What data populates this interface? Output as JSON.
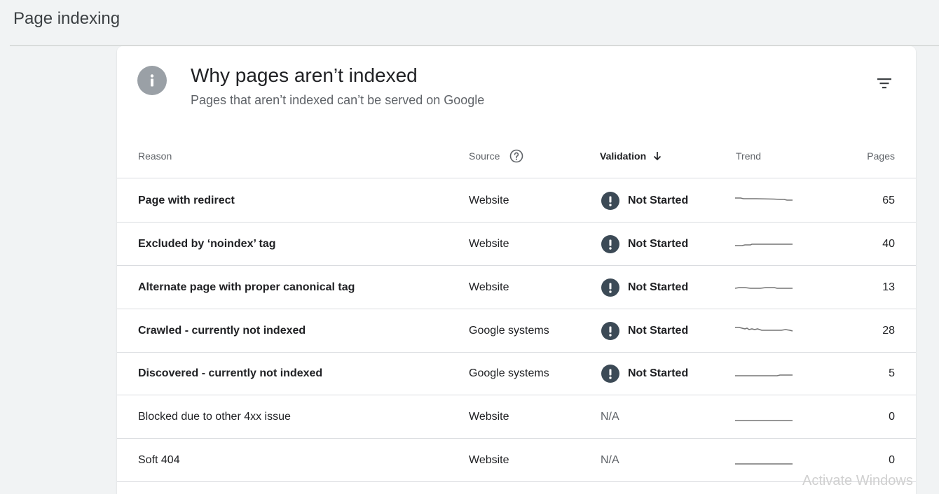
{
  "header": {
    "title": "Page indexing"
  },
  "card": {
    "title": "Why pages aren’t indexed",
    "subtitle": "Pages that aren’t indexed can’t be served on Google"
  },
  "columns": {
    "reason": "Reason",
    "source": "Source",
    "validation": "Validation",
    "trend": "Trend",
    "pages": "Pages"
  },
  "rows": [
    {
      "reason": "Page with redirect",
      "source": "Website",
      "validation": "Not Started",
      "pages": "65",
      "bold": true
    },
    {
      "reason": "Excluded by ‘noindex’ tag",
      "source": "Website",
      "validation": "Not Started",
      "pages": "40",
      "bold": true
    },
    {
      "reason": "Alternate page with proper canonical tag",
      "source": "Website",
      "validation": "Not Started",
      "pages": "13",
      "bold": true
    },
    {
      "reason": "Crawled - currently not indexed",
      "source": "Google systems",
      "validation": "Not Started",
      "pages": "28",
      "bold": true
    },
    {
      "reason": "Discovered - currently not indexed",
      "source": "Google systems",
      "validation": "Not Started",
      "pages": "5",
      "bold": true
    },
    {
      "reason": "Blocked due to other 4xx issue",
      "source": "Website",
      "validation": "N/A",
      "pages": "0",
      "bold": false
    },
    {
      "reason": "Soft 404",
      "source": "Website",
      "validation": "N/A",
      "pages": "0",
      "bold": false
    }
  ],
  "colors": {
    "warning_icon": "#3c4a56",
    "info_icon": "#9aa0a6",
    "sparkline": "#757575"
  },
  "watermark": "Activate Windows"
}
